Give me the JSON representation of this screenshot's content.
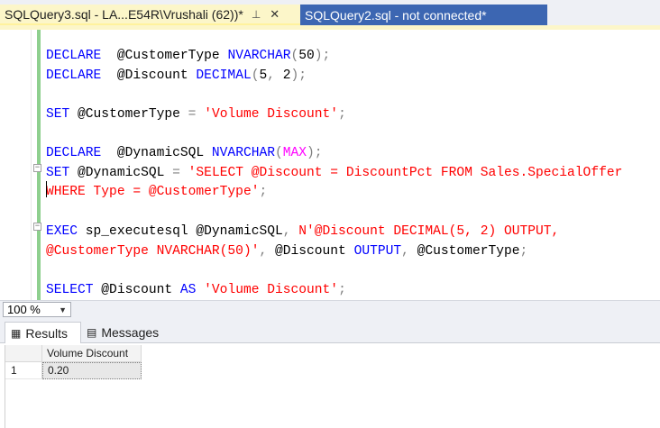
{
  "tabs": [
    {
      "label": "SQLQuery3.sql - LA...E54R\\Vrushali (62))*",
      "pin": "⊥",
      "close": "✕",
      "active": true
    },
    {
      "label": "SQLQuery2.sql - not connected*",
      "active": false
    }
  ],
  "editor": {
    "lines": [
      {
        "t": [
          [
            "kw",
            "DECLARE"
          ],
          [
            "",
            "  @CustomerType "
          ],
          [
            "kw",
            "NVARCHAR"
          ],
          [
            "op",
            "("
          ],
          [
            "",
            "50"
          ],
          [
            "op",
            ");"
          ]
        ]
      },
      {
        "t": [
          [
            "kw",
            "DECLARE"
          ],
          [
            "",
            "  @Discount "
          ],
          [
            "kw",
            "DECIMAL"
          ],
          [
            "op",
            "("
          ],
          [
            "",
            "5"
          ],
          [
            "op",
            ","
          ],
          [
            "",
            " 2"
          ],
          [
            "op",
            ");"
          ]
        ]
      },
      {
        "t": []
      },
      {
        "t": [
          [
            "kw",
            "SET"
          ],
          [
            "",
            " @CustomerType "
          ],
          [
            "op",
            "="
          ],
          [
            "",
            " "
          ],
          [
            "str",
            "'Volume Discount'"
          ],
          [
            "op",
            ";"
          ]
        ]
      },
      {
        "t": []
      },
      {
        "t": [
          [
            "kw",
            "DECLARE"
          ],
          [
            "",
            "  @DynamicSQL "
          ],
          [
            "kw",
            "NVARCHAR"
          ],
          [
            "op",
            "("
          ],
          [
            "fn",
            "MAX"
          ],
          [
            "op",
            ");"
          ]
        ]
      },
      {
        "t": [
          [
            "kw",
            "SET"
          ],
          [
            "",
            " @DynamicSQL "
          ],
          [
            "op",
            "="
          ],
          [
            "",
            " "
          ],
          [
            "str",
            "'SELECT @Discount = DiscountPct FROM Sales.SpecialOffer"
          ]
        ]
      },
      {
        "t": [
          [
            "str",
            "WHERE Type = @CustomerType'"
          ],
          [
            "op",
            ";"
          ]
        ]
      },
      {
        "t": []
      },
      {
        "t": [
          [
            "kw",
            "EXEC"
          ],
          [
            "",
            " sp_executesql @DynamicSQL"
          ],
          [
            "op",
            ","
          ],
          [
            "",
            " "
          ],
          [
            "str",
            "N'@Discount DECIMAL(5, 2) OUTPUT,"
          ]
        ]
      },
      {
        "t": [
          [
            "str",
            "@CustomerType NVARCHAR(50)'"
          ],
          [
            "op",
            ","
          ],
          [
            "",
            " @Discount "
          ],
          [
            "kw",
            "OUTPUT"
          ],
          [
            "op",
            ","
          ],
          [
            "",
            " @CustomerType"
          ],
          [
            "op",
            ";"
          ]
        ]
      },
      {
        "t": []
      },
      {
        "t": [
          [
            "kw",
            "SELECT"
          ],
          [
            "",
            " @Discount "
          ],
          [
            "kw",
            "AS"
          ],
          [
            "",
            " "
          ],
          [
            "str",
            "'Volume Discount'"
          ],
          [
            "op",
            ";"
          ]
        ]
      }
    ]
  },
  "zoom": {
    "value": "100 %",
    "arrow": "▼"
  },
  "results": {
    "tabs": [
      {
        "label": "Results",
        "icon": "▦"
      },
      {
        "label": "Messages",
        "icon": "▤"
      }
    ],
    "columns": [
      "Volume Discount"
    ],
    "rows": [
      {
        "num": "1",
        "cells": [
          "0.20"
        ]
      }
    ]
  },
  "colors": {
    "keyword": "#0000ff",
    "string": "#ff0000",
    "function": "#ff00ff",
    "operator": "#808080",
    "active_tab": "#fcf6c9",
    "inactive_tab": "#3c66b2"
  }
}
